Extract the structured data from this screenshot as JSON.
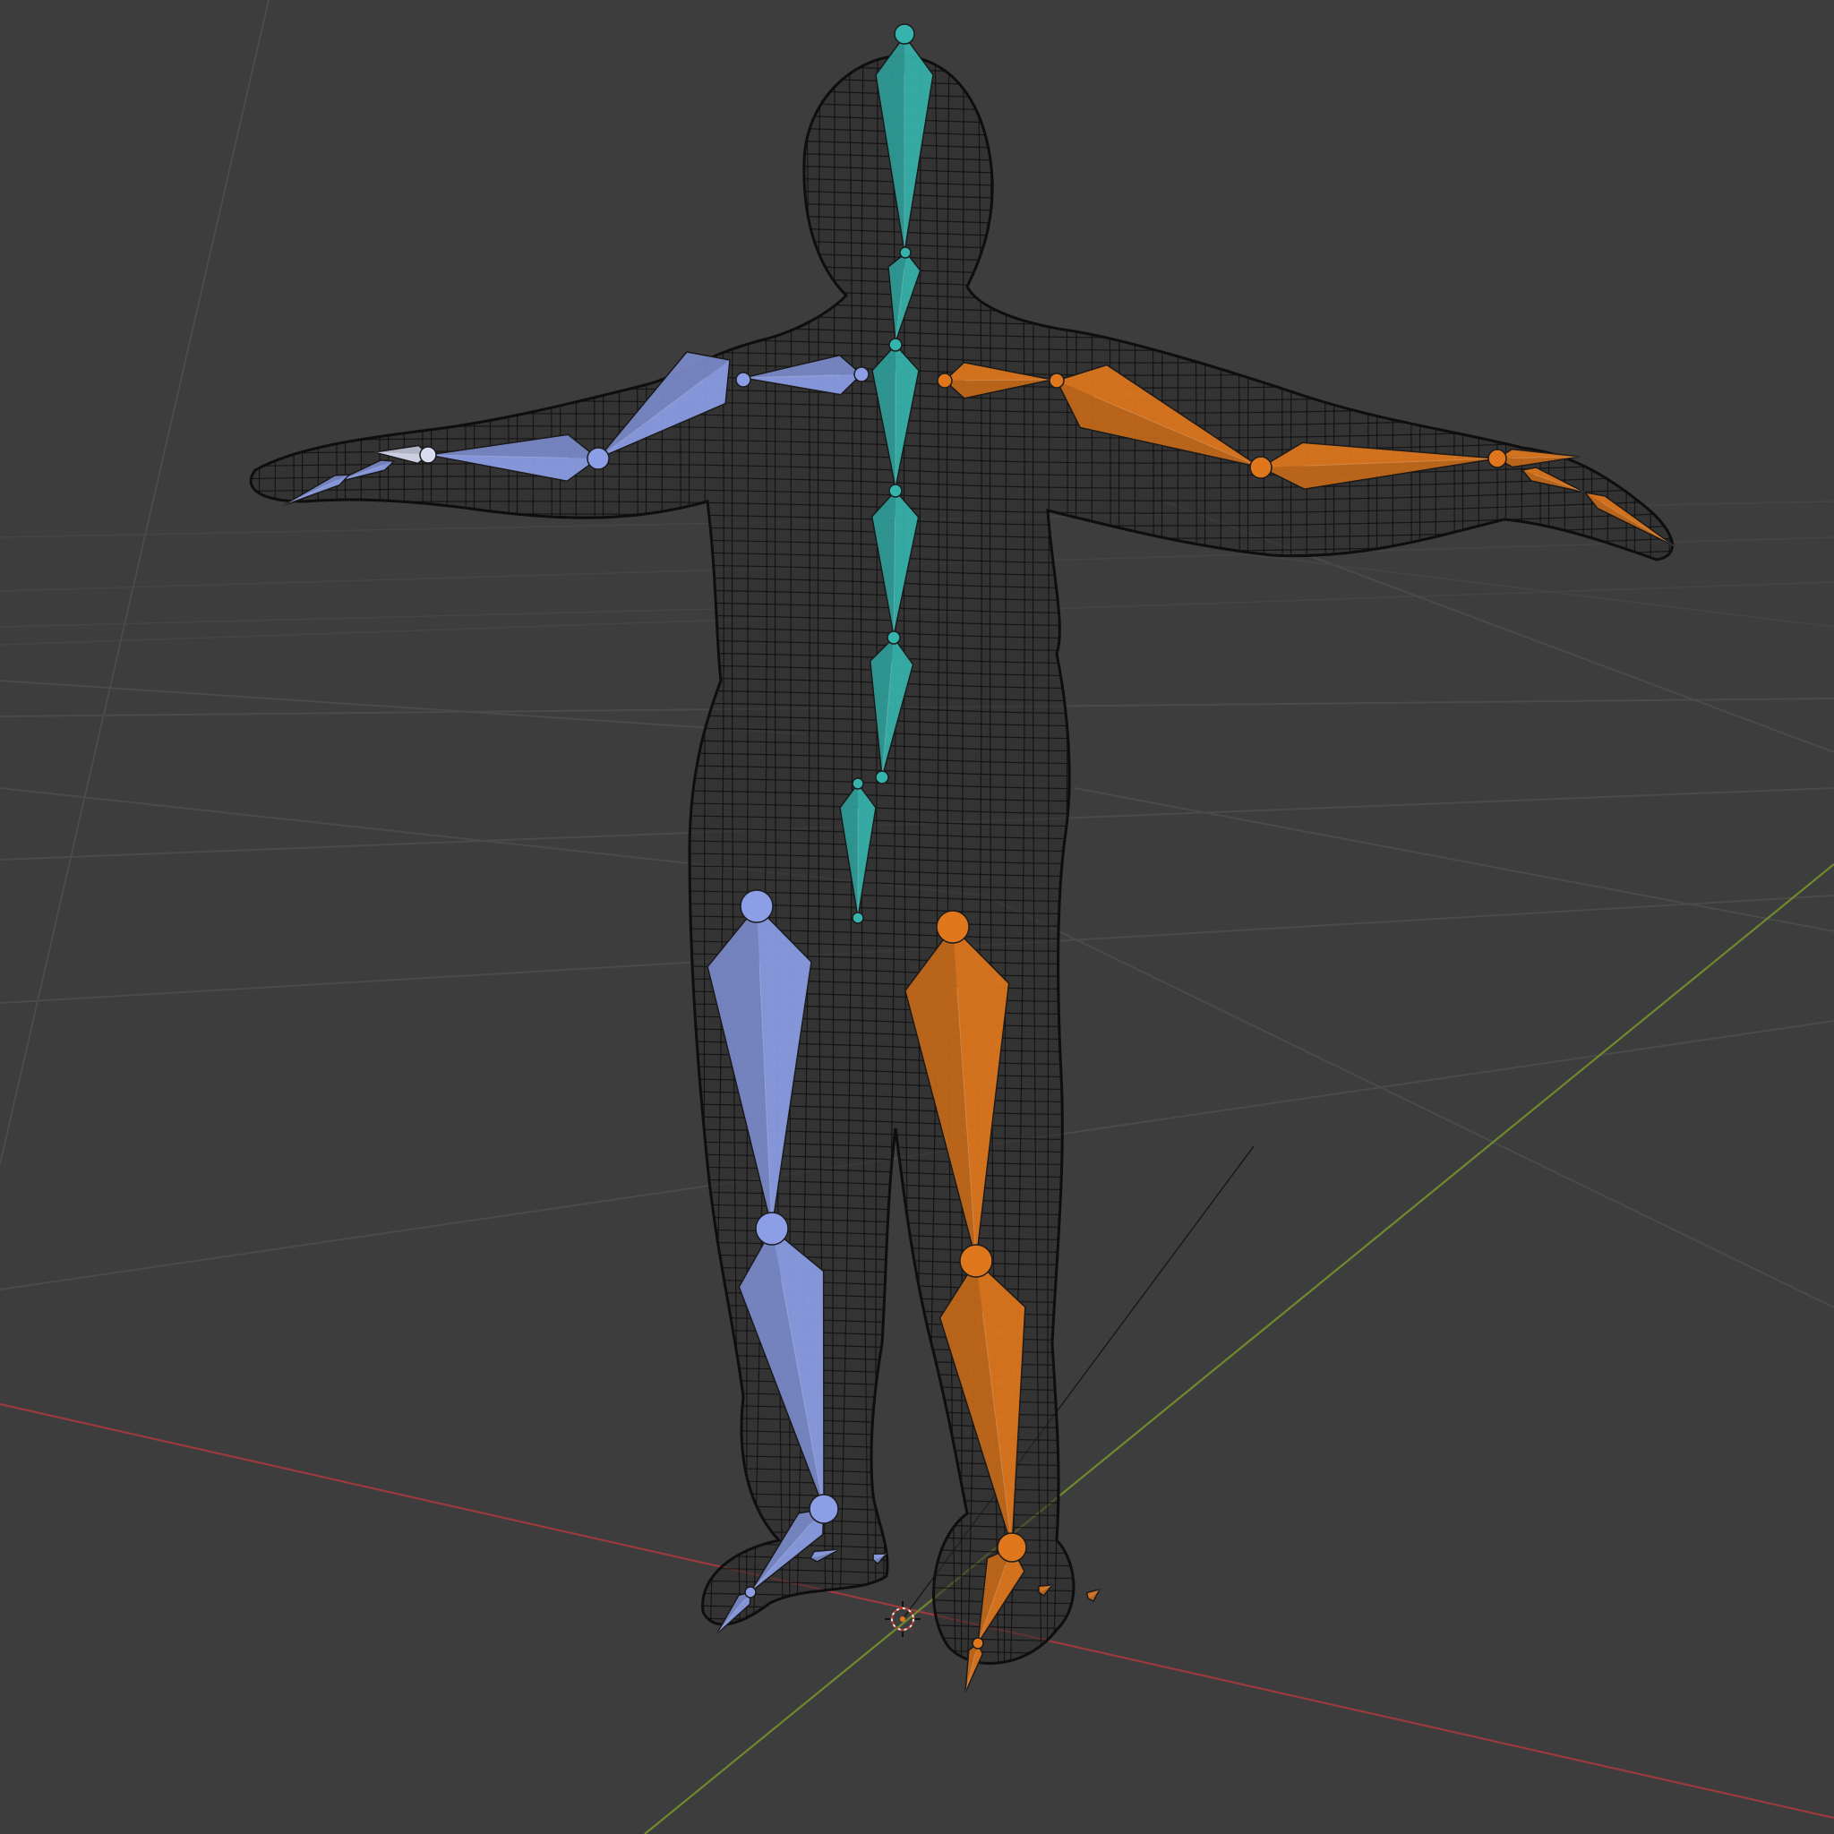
{
  "viewport": {
    "name": "3D Viewport",
    "shading": "wireframe",
    "object": "armature-with-mesh"
  },
  "colors": {
    "background": "#3d3d3d",
    "grid": "#4a4a4a",
    "axis_x": "#9b3a3f",
    "axis_y": "#6f8a2c",
    "bones_center": "#36b3ad",
    "bones_left": "#8c9ee6",
    "bones_right": "#e0771d",
    "mesh_wire": "#111111"
  },
  "icons": {
    "origin": "3d-cursor-icon"
  }
}
